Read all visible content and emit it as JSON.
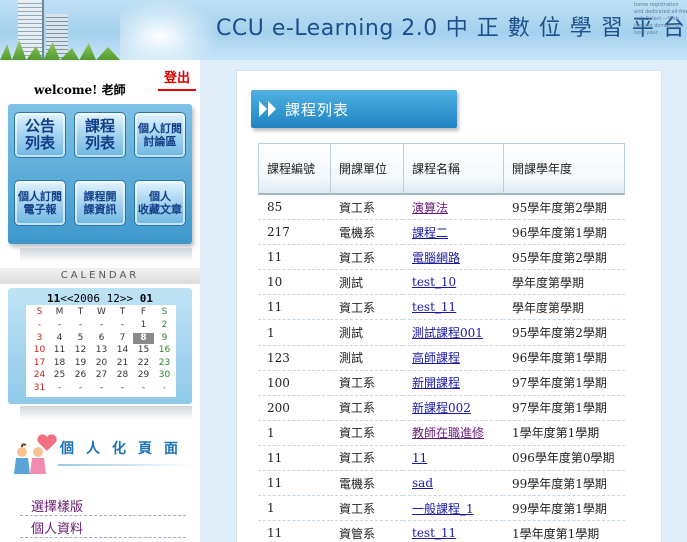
{
  "header": {
    "title_en": "CCU e-Learning 2.0",
    "title_cn": "中正數位學習平台",
    "fine_print": "home registration and dedicated all-free web Select —Web hosting domain to host your"
  },
  "sidebar": {
    "welcome": "welcome! 老師",
    "logout": "登出",
    "menu": [
      {
        "label": "公告\n列表"
      },
      {
        "label": "課程\n列表"
      },
      {
        "label": "個人訂閱\n討論區"
      },
      {
        "label": "個人訂閱\n電子報"
      },
      {
        "label": "課程開\n課資訊"
      },
      {
        "label": "個人\n收藏文章"
      }
    ],
    "calendar": {
      "title": "CALENDAR",
      "month": "11",
      "prev": "<<",
      "year": "2006",
      "month_nav": "12",
      "next": ">>",
      "day": "01",
      "weekdays": [
        "S",
        "M",
        "T",
        "W",
        "T",
        "F",
        "S"
      ],
      "rows": [
        [
          "-",
          "-",
          "-",
          "-",
          "-",
          "1",
          "2"
        ],
        [
          "3",
          "4",
          "5",
          "6",
          "7",
          "8",
          "9"
        ],
        [
          "10",
          "11",
          "12",
          "13",
          "14",
          "15",
          "16"
        ],
        [
          "17",
          "18",
          "19",
          "20",
          "21",
          "22",
          "23"
        ],
        [
          "24",
          "25",
          "26",
          "27",
          "28",
          "29",
          "30"
        ],
        [
          "31",
          "-",
          "-",
          "-",
          "-",
          "-",
          "-"
        ]
      ],
      "today": "8"
    },
    "personal_title": "個人化頁面",
    "links": [
      {
        "label": "選擇樣版"
      },
      {
        "label": "個人資料"
      }
    ]
  },
  "main": {
    "title": "課程列表",
    "columns": [
      "課程編號",
      "開課單位",
      "課程名稱",
      "開課學年度"
    ],
    "rows": [
      {
        "id": "85",
        "unit": "資工系",
        "name": "演算法",
        "term": "95學年度第2學期",
        "visited": true
      },
      {
        "id": "217",
        "unit": "電機系",
        "name": "課程二",
        "term": "96學年度第1學期",
        "visited": false
      },
      {
        "id": "11",
        "unit": "資工系",
        "name": "電腦網路",
        "term": "95學年度第2學期",
        "visited": false
      },
      {
        "id": "10",
        "unit": "測試",
        "name": "test_10",
        "term": "學年度第學期",
        "visited": false
      },
      {
        "id": "11",
        "unit": "資工系",
        "name": "test_11",
        "term": "學年度第學期",
        "visited": false
      },
      {
        "id": "1",
        "unit": "測試",
        "name": "測試課程001",
        "term": "95學年度第2學期",
        "visited": false
      },
      {
        "id": "123",
        "unit": "測試",
        "name": "高師課程",
        "term": "96學年度第1學期",
        "visited": false
      },
      {
        "id": "100",
        "unit": "資工系",
        "name": "新開課程",
        "term": "97學年度第1學期",
        "visited": false
      },
      {
        "id": "200",
        "unit": "資工系",
        "name": "新課程002",
        "term": "97學年度第1學期",
        "visited": false
      },
      {
        "id": "1",
        "unit": "資工系",
        "name": "教師在職進修",
        "term": "1學年度第1學期",
        "visited": true
      },
      {
        "id": "11",
        "unit": "資工系",
        "name": "11",
        "term": "096學年度第0學期",
        "visited": false
      },
      {
        "id": "11",
        "unit": "電機系",
        "name": "sad",
        "term": "99學年度第1學期",
        "visited": false
      },
      {
        "id": "1",
        "unit": "資工系",
        "name": "一般課程_1",
        "term": "99學年度第1學期",
        "visited": false
      },
      {
        "id": "11",
        "unit": "資管系",
        "name": "test_11",
        "term": "1學年度第1學期",
        "visited": false
      }
    ]
  },
  "colors": {
    "title_blue": "#1d4f8a",
    "logout_red": "#d80000",
    "link_blue": "#1a1aa6",
    "visited_purple": "#6b1b79",
    "accent_blue": "#1f83c2"
  }
}
